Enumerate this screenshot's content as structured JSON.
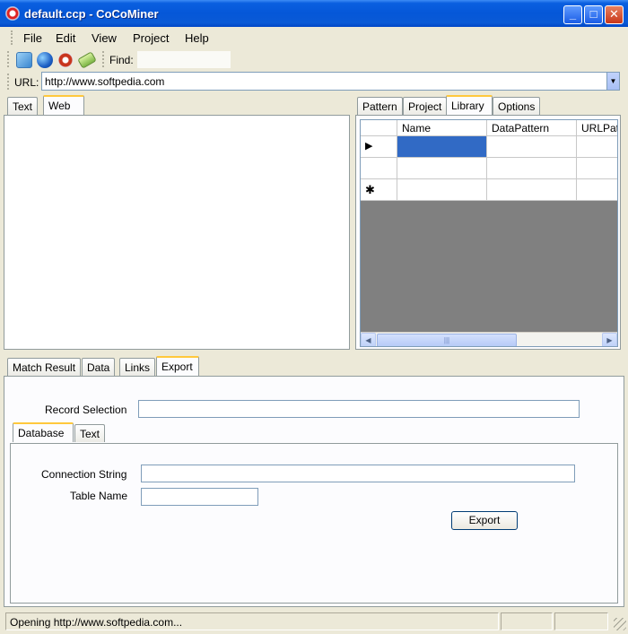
{
  "window": {
    "title": "default.ccp - CoCoMiner"
  },
  "menu": {
    "items": [
      "File",
      "Edit",
      "View",
      "Project",
      "Help"
    ]
  },
  "toolbar": {
    "find_label": "Find:",
    "find_value": "",
    "icons": [
      "open-icon",
      "web-globe-icon",
      "stop-icon",
      "pattern-icon"
    ]
  },
  "urlbar": {
    "label": "URL:",
    "value": "http://www.softpedia.com"
  },
  "left_panel": {
    "tabs": [
      "Text",
      "Web"
    ],
    "active_tab": "Web"
  },
  "right_panel": {
    "tabs": [
      "Pattern",
      "Project",
      "Library",
      "Options"
    ],
    "active_tab": "Library",
    "grid": {
      "columns": [
        "Name",
        "DataPattern",
        "URLPat"
      ],
      "row_markers": [
        "▶",
        "",
        "✱"
      ]
    }
  },
  "bottom_panel": {
    "tabs": [
      "Match Result",
      "Data",
      "Links",
      "Export"
    ],
    "active_tab": "Export",
    "record_selection_label": "Record Selection",
    "record_selection_value": "",
    "sub_tabs": [
      "Database",
      "Text"
    ],
    "active_sub_tab": "Database",
    "connection_string_label": "Connection String",
    "connection_string_value": "",
    "table_name_label": "Table Name",
    "table_name_value": "",
    "export_button": "Export"
  },
  "status": {
    "text": "Opening http://www.softpedia.com..."
  },
  "colors": {
    "title_blue": "#0557d8",
    "selected_cell": "#316ac5",
    "tab_highlight": "#ffc83c"
  }
}
